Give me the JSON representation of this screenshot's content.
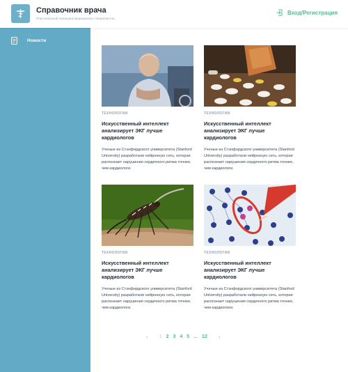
{
  "header": {
    "title": "Справочник врача",
    "subtitle": "Персональный помощник медицинских специалистов",
    "login_label": "Вход/Регистрация",
    "colors": {
      "accent": "#4ec08c",
      "sidebar": "#62aac6"
    }
  },
  "sidebar": {
    "items": [
      {
        "label": "Новости",
        "icon": "document-icon"
      }
    ]
  },
  "news": [
    {
      "category": "ТЕХНОЛОГИИ",
      "title": "Искусственный интеллект анализирует ЭКГ лучше кардиологов",
      "description": "Ученые из Стэнфордского университета (Stanford University) разработали нейронную сеть, которая распознает нарушения сердечного ритма точнее, чем кардиологи.",
      "image": "elderly-man-photo"
    },
    {
      "category": "ТЕХНОЛОГИИ",
      "title": "Искусственный интеллект анализирует ЭКГ лучше кардиологов",
      "description": "Ученые из Стэнфордского университета (Stanford University) разработали нейронную сеть, которая распознает нарушения сердечного ритма точнее, чем кардиологи.",
      "image": "pills-photo"
    },
    {
      "category": "ТЕХНОЛОГИИ",
      "title": "Искусственный интеллект анализирует ЭКГ лучше кардиологов",
      "description": "Ученые из Стэнфордского университета (Stanford University) разработали нейронную сеть, которая распознает нарушения сердечного ритма точнее, чем кардиологи.",
      "image": "mosquito-photo"
    },
    {
      "category": "ТЕХНОЛОГИИ",
      "title": "Искусственный интеллект анализирует ЭКГ лучше кардиологов",
      "description": "Ученые из Стэнфордского университета (Stanford University) разработали нейронную сеть, которая распознает нарушения сердечного ритма точнее, чем кардиологи.",
      "image": "cells-photo"
    }
  ],
  "pagination": {
    "prev": "‹",
    "pages": [
      "1",
      "2",
      "3",
      "4",
      "5"
    ],
    "current": "1",
    "dots": "...",
    "last": "12",
    "next": "›"
  }
}
